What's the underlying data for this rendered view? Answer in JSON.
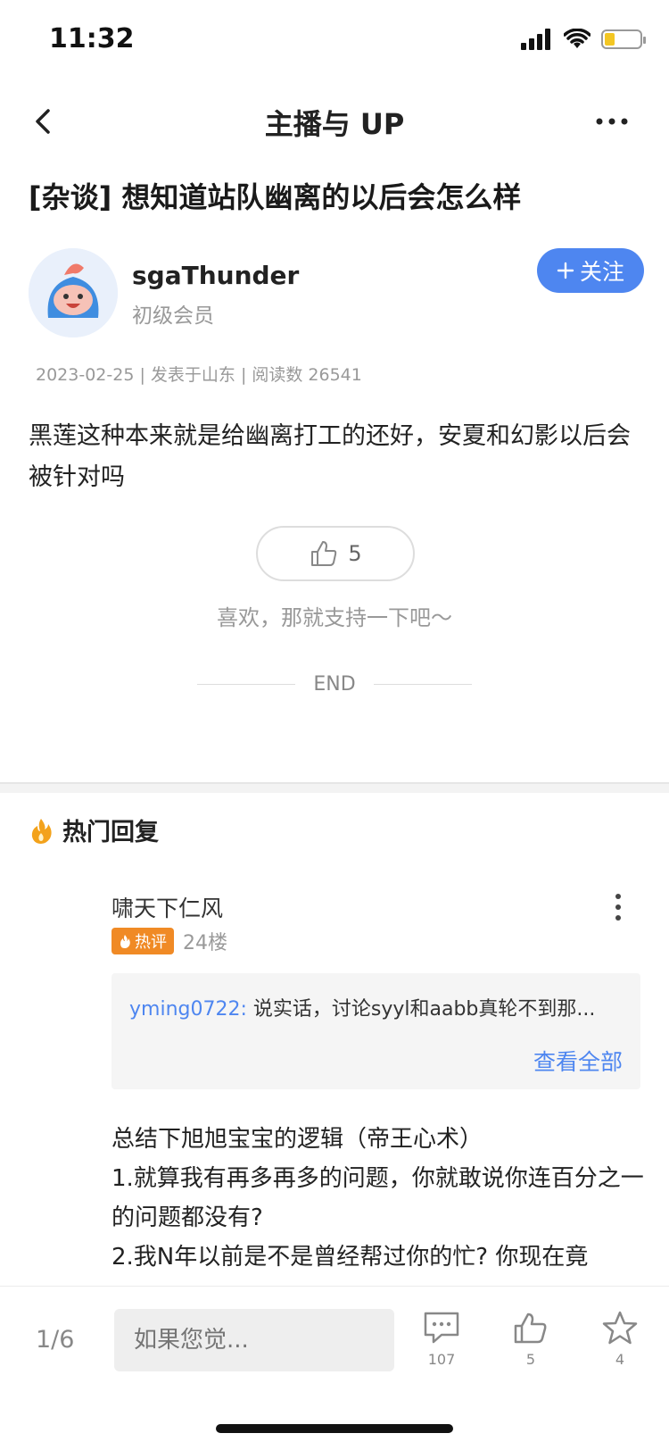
{
  "status_bar": {
    "time": "11:32",
    "battery_level": 0.3
  },
  "nav": {
    "title": "主播与 UP",
    "back_icon": "chevron-left-icon",
    "more_icon": "more-horizontal-icon"
  },
  "post": {
    "title": "[杂谈] 想知道站队幽离的以后会怎么样",
    "author": {
      "name": "sgaThunder",
      "level": "初级会员"
    },
    "follow_label": "关注",
    "meta": "2023-02-25 | 发表于山东 | 阅读数 26541",
    "body": "黑莲这种本来就是给幽离打工的还好，安夏和幻影以后会被针对吗",
    "like_count": "5",
    "like_hint": "喜欢，那就支持一下吧～",
    "end_label": "END"
  },
  "hot_replies": {
    "title": "热门回复",
    "items": [
      {
        "user": "啸天下仁风",
        "badge": "热评",
        "floor": "24楼",
        "quote_author": "yming0722:",
        "quote_text": "说实话，讨论syyl和aabb真轮不到那...",
        "view_all": "查看全部",
        "body_lines": [
          "总结下旭旭宝宝的逻辑（帝王心术）",
          "1.就算我有再多再多的问题，你就敢说你连百分之一的问题都没有?",
          "2.我N年以前是不是曾经帮过你的忙? 你现在竟"
        ]
      }
    ]
  },
  "bottom_bar": {
    "page": "1/6",
    "input_placeholder": "如果您觉...",
    "comment_count": "107",
    "like_count": "5",
    "favorite_count": "4"
  },
  "colors": {
    "accent": "#4e86f0",
    "hot": "#f08a25",
    "battery": "#f3c623"
  }
}
